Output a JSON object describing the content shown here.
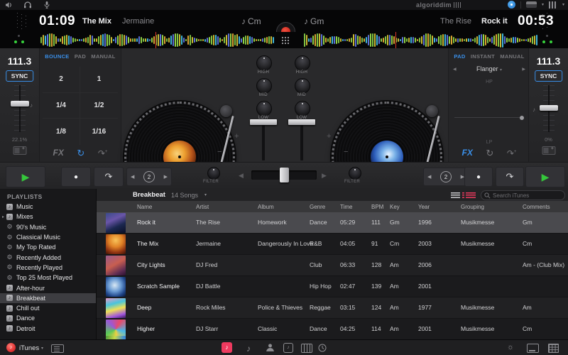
{
  "icons": {
    "play": "▶",
    "record_dot": "●",
    "loop": "↻",
    "bend": "↷",
    "caret": "▾",
    "left_arrow": "◀",
    "right_arrow": "▶",
    "disclosure": "▸",
    "note": "♪",
    "gear": "⚙",
    "plus": "+",
    "minus": "−",
    "sun": "☼"
  },
  "colors": {
    "accent_blue": "#3a8fe8",
    "accent_pink": "#ee3a5f",
    "playhead_red": "#e0352a",
    "play_green": "#35c63b",
    "record_red": "#e02525",
    "wave_palette": [
      "#7dc243",
      "#c9b832",
      "#3fb6d9",
      "#5b6fd6",
      "#8fd146",
      "#d9a232"
    ]
  },
  "menubar": {
    "logo": "algoriddim"
  },
  "deck_left": {
    "time": "01:09",
    "title": "The Mix",
    "artist": "Jermaine",
    "key": "Cm",
    "bpm": "111.3",
    "sync_label": "SYNC",
    "pitch_percent": "22.1%",
    "tabs": [
      "BOUNCE",
      "PAD",
      "MANUAL"
    ],
    "active_tab": "BOUNCE",
    "pads": [
      "2",
      "1",
      "1/4",
      "1/2",
      "1/8",
      "1/16"
    ],
    "fx_label": "FX",
    "loop_count": "2",
    "wave_playhead": 0.49,
    "label_art": "radial-gradient(circle at 42% 40%, #f8d27a 0%, #eda030 28%, #b5541a 55%, #5a2008 78%, #2a0d04 100%)"
  },
  "deck_right": {
    "time": "00:53",
    "title": "Rock it",
    "artist": "The Rise",
    "key": "Gm",
    "bpm": "111.3",
    "sync_label": "SYNC",
    "pitch_percent": "0%",
    "tabs": [
      "PAD",
      "INSTANT",
      "MANUAL"
    ],
    "active_tab": "PAD",
    "fx_name": "Flanger",
    "pad_axis_top": "HP",
    "pad_axis_bottom": "LP",
    "fx_label": "FX",
    "loop_count": "2",
    "wave_playhead": 0.39,
    "label_art": "radial-gradient(circle at 55% 42%, #e8f4ff 0%, #7ab2e8 25%, #2a5ab8 55%, #101c4a 80%, #05081c 100%)"
  },
  "mixer": {
    "eq_labels": [
      "HIGH",
      "MID",
      "LOW"
    ],
    "filter_label": "FILTER"
  },
  "sidebar": {
    "header": "PLAYLISTS",
    "items": [
      {
        "label": "Music",
        "icon": "media"
      },
      {
        "label": "Mixes",
        "icon": "media",
        "disclosure": true
      },
      {
        "label": "90's Music",
        "icon": "smart"
      },
      {
        "label": "Classical Music",
        "icon": "smart"
      },
      {
        "label": "My Top Rated",
        "icon": "smart"
      },
      {
        "label": "Recently Added",
        "icon": "smart"
      },
      {
        "label": "Recently Played",
        "icon": "smart"
      },
      {
        "label": "Top 25 Most Played",
        "icon": "smart"
      },
      {
        "label": "After-hour",
        "icon": "playlist"
      },
      {
        "label": "Breakbeat",
        "icon": "playlist",
        "selected": true
      },
      {
        "label": "Chill out",
        "icon": "playlist"
      },
      {
        "label": "Dance",
        "icon": "playlist"
      },
      {
        "label": "Detroit",
        "icon": "playlist"
      }
    ],
    "source": "iTunes"
  },
  "library": {
    "playlist_title": "Breakbeat",
    "song_count": "14 Songs",
    "search_placeholder": "Search iTunes",
    "columns": [
      "Name",
      "Artist",
      "Album",
      "Genre",
      "Time",
      "BPM",
      "Key",
      "Year",
      "Grouping",
      "Comments"
    ],
    "rows": [
      {
        "selected": true,
        "art": "linear-gradient(155deg,#3a4a8a 0%,#6a55a8 35%,#1c2850 65%,#0a0f26 100%)",
        "fields": [
          "Rock it",
          "The Rise",
          "Homework",
          "Dance",
          "05:29",
          "111",
          "Gm",
          "1996",
          "Musikmesse",
          "Gm"
        ]
      },
      {
        "art": "radial-gradient(circle at 50% 30%,#f8c35a 0%,#e08226 40%,#923512 72%,#3a1206 100%)",
        "fields": [
          "The Mix",
          "Jermaine",
          "Dangerously In Love",
          "R&B",
          "04:05",
          "91",
          "Cm",
          "2003",
          "Musikmesse",
          "Cm"
        ]
      },
      {
        "art": "linear-gradient(150deg,#9a5a8a 0%,#c85e50 45%,#5e2c52 78%,#2a1030 100%)",
        "fields": [
          "City Lights",
          "DJ Fred",
          "",
          "Club",
          "06:33",
          "128",
          "Am",
          "2006",
          "",
          "Am - (Club Mix)"
        ]
      },
      {
        "art": "radial-gradient(circle at 45% 42%,#d8e8f4 0%,#6a9ad2 40%,#1e4488 72%,#081430 100%)",
        "fields": [
          "Scratch Sample",
          "DJ Battle",
          "",
          "Hip Hop",
          "02:47",
          "139",
          "Am",
          "2001",
          "",
          ""
        ]
      },
      {
        "art": "linear-gradient(165deg,#e89ac8 0%,#48c4dc 30%,#f0e055 55%,#a055dc 82%,#3a1a5a 100%)",
        "fields": [
          "Deep",
          "Rock Miles",
          "Police & Thieves",
          "Reggae",
          "03:15",
          "124",
          "Am",
          "1977",
          "Musikmesse",
          "Am"
        ]
      },
      {
        "art": "conic-gradient(from 30deg,#e84a6a,#48b8e8,#f0d040,#58c858,#9a58d8,#e84a6a)",
        "fields": [
          "Higher",
          "DJ Starr",
          "Classic",
          "Dance",
          "04:25",
          "114",
          "Am",
          "2001",
          "Musikmesse",
          "Cm"
        ]
      }
    ],
    "partial_row_art": "linear-gradient(100deg,#4a9a3a,#c8d84a 40%,#3a8ad8 80%)"
  }
}
